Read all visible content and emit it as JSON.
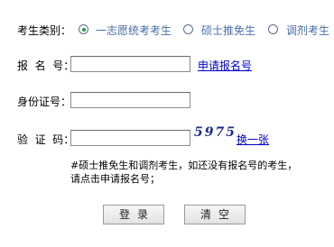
{
  "form": {
    "category_label": "考生类别：",
    "category_options": [
      {
        "label": "一志愿统考考生",
        "checked": true
      },
      {
        "label": "硕士推免生",
        "checked": false
      },
      {
        "label": "调剂考生",
        "checked": false
      }
    ],
    "reg_no_label": "报  名  号：",
    "reg_no_value": "",
    "apply_link": "申请报名号",
    "id_label": "身份证号：",
    "id_value": "",
    "captcha_label": "验  证  码：",
    "captcha_value": "",
    "captcha_code": "5975",
    "refresh_link": "换一张",
    "note_line1": "#硕士推免生和调剂考生，如还没有报名号的考生，",
    "note_line2": "请点击申请报名号；",
    "login_button": "登录",
    "clear_button": "清空"
  }
}
